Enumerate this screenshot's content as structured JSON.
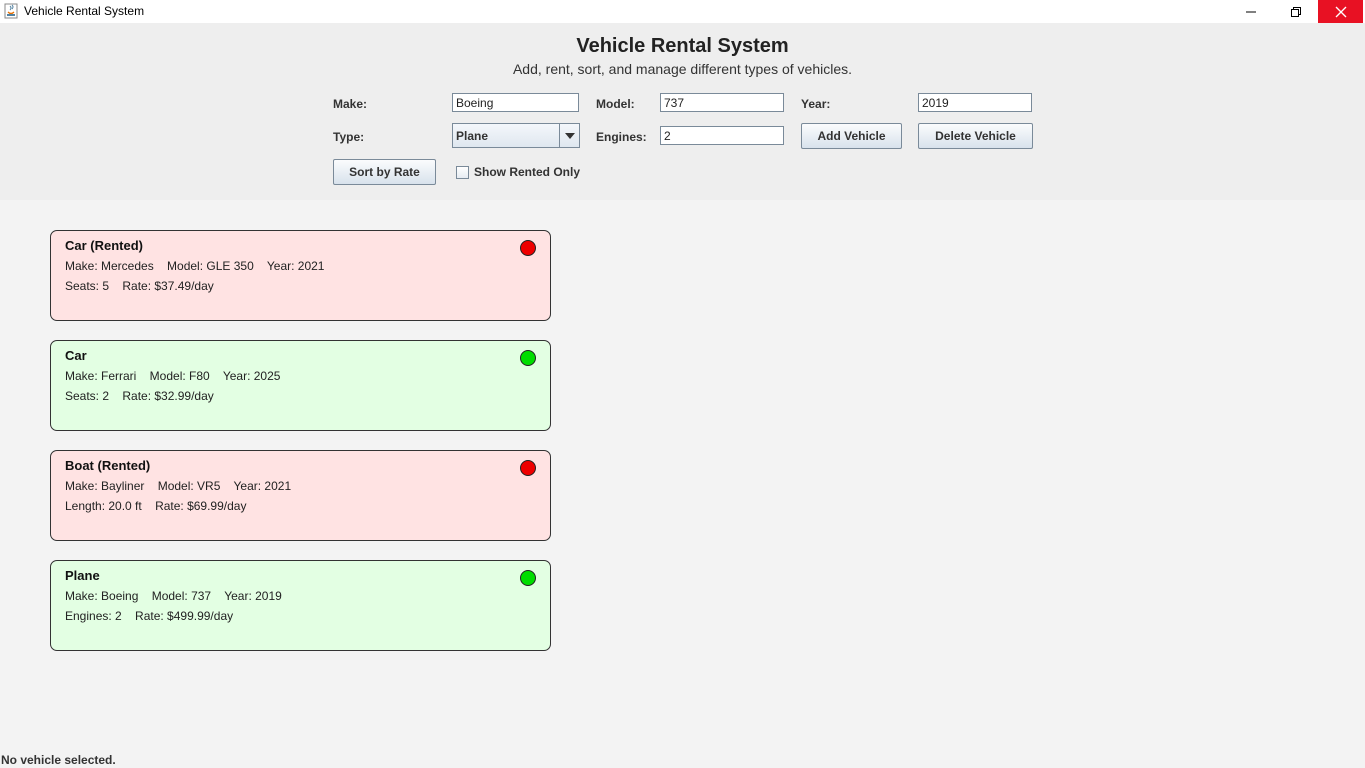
{
  "window": {
    "title": "Vehicle Rental System",
    "close_color": "#e81123"
  },
  "header": {
    "title": "Vehicle Rental System",
    "subtitle": "Add, rent, sort, and manage different types of vehicles."
  },
  "form": {
    "make_label": "Make:",
    "make_value": "Boeing",
    "model_label": "Model:",
    "model_value": "737",
    "year_label": "Year:",
    "year_value": "2019",
    "type_label": "Type:",
    "type_value": "Plane",
    "engines_label": "Engines:",
    "engines_value": "2",
    "add_button": "Add Vehicle",
    "delete_button": "Delete Vehicle",
    "sort_button": "Sort by Rate",
    "show_rented_label": "Show Rented Only",
    "show_rented_checked": false
  },
  "colors": {
    "rented_bg": "#ffe3e3",
    "available_bg": "#e3ffe3",
    "rented_dot": "#ee0000",
    "available_dot": "#00dd00"
  },
  "vehicles": [
    {
      "title": "Car (Rented)",
      "status": "rented",
      "line1": "Make: Mercedes    Model: GLE 350    Year: 2021",
      "line2": "Seats: 5    Rate: $37.49/day"
    },
    {
      "title": "Car",
      "status": "available",
      "line1": "Make: Ferrari    Model: F80    Year: 2025",
      "line2": "Seats: 2    Rate: $32.99/day"
    },
    {
      "title": "Boat (Rented)",
      "status": "rented",
      "line1": "Make: Bayliner    Model: VR5    Year: 2021",
      "line2": "Length: 20.0 ft    Rate: $69.99/day"
    },
    {
      "title": "Plane",
      "status": "available",
      "line1": "Make: Boeing    Model: 737    Year: 2019",
      "line2": "Engines: 2    Rate: $499.99/day"
    }
  ],
  "status_bar": "No vehicle selected."
}
